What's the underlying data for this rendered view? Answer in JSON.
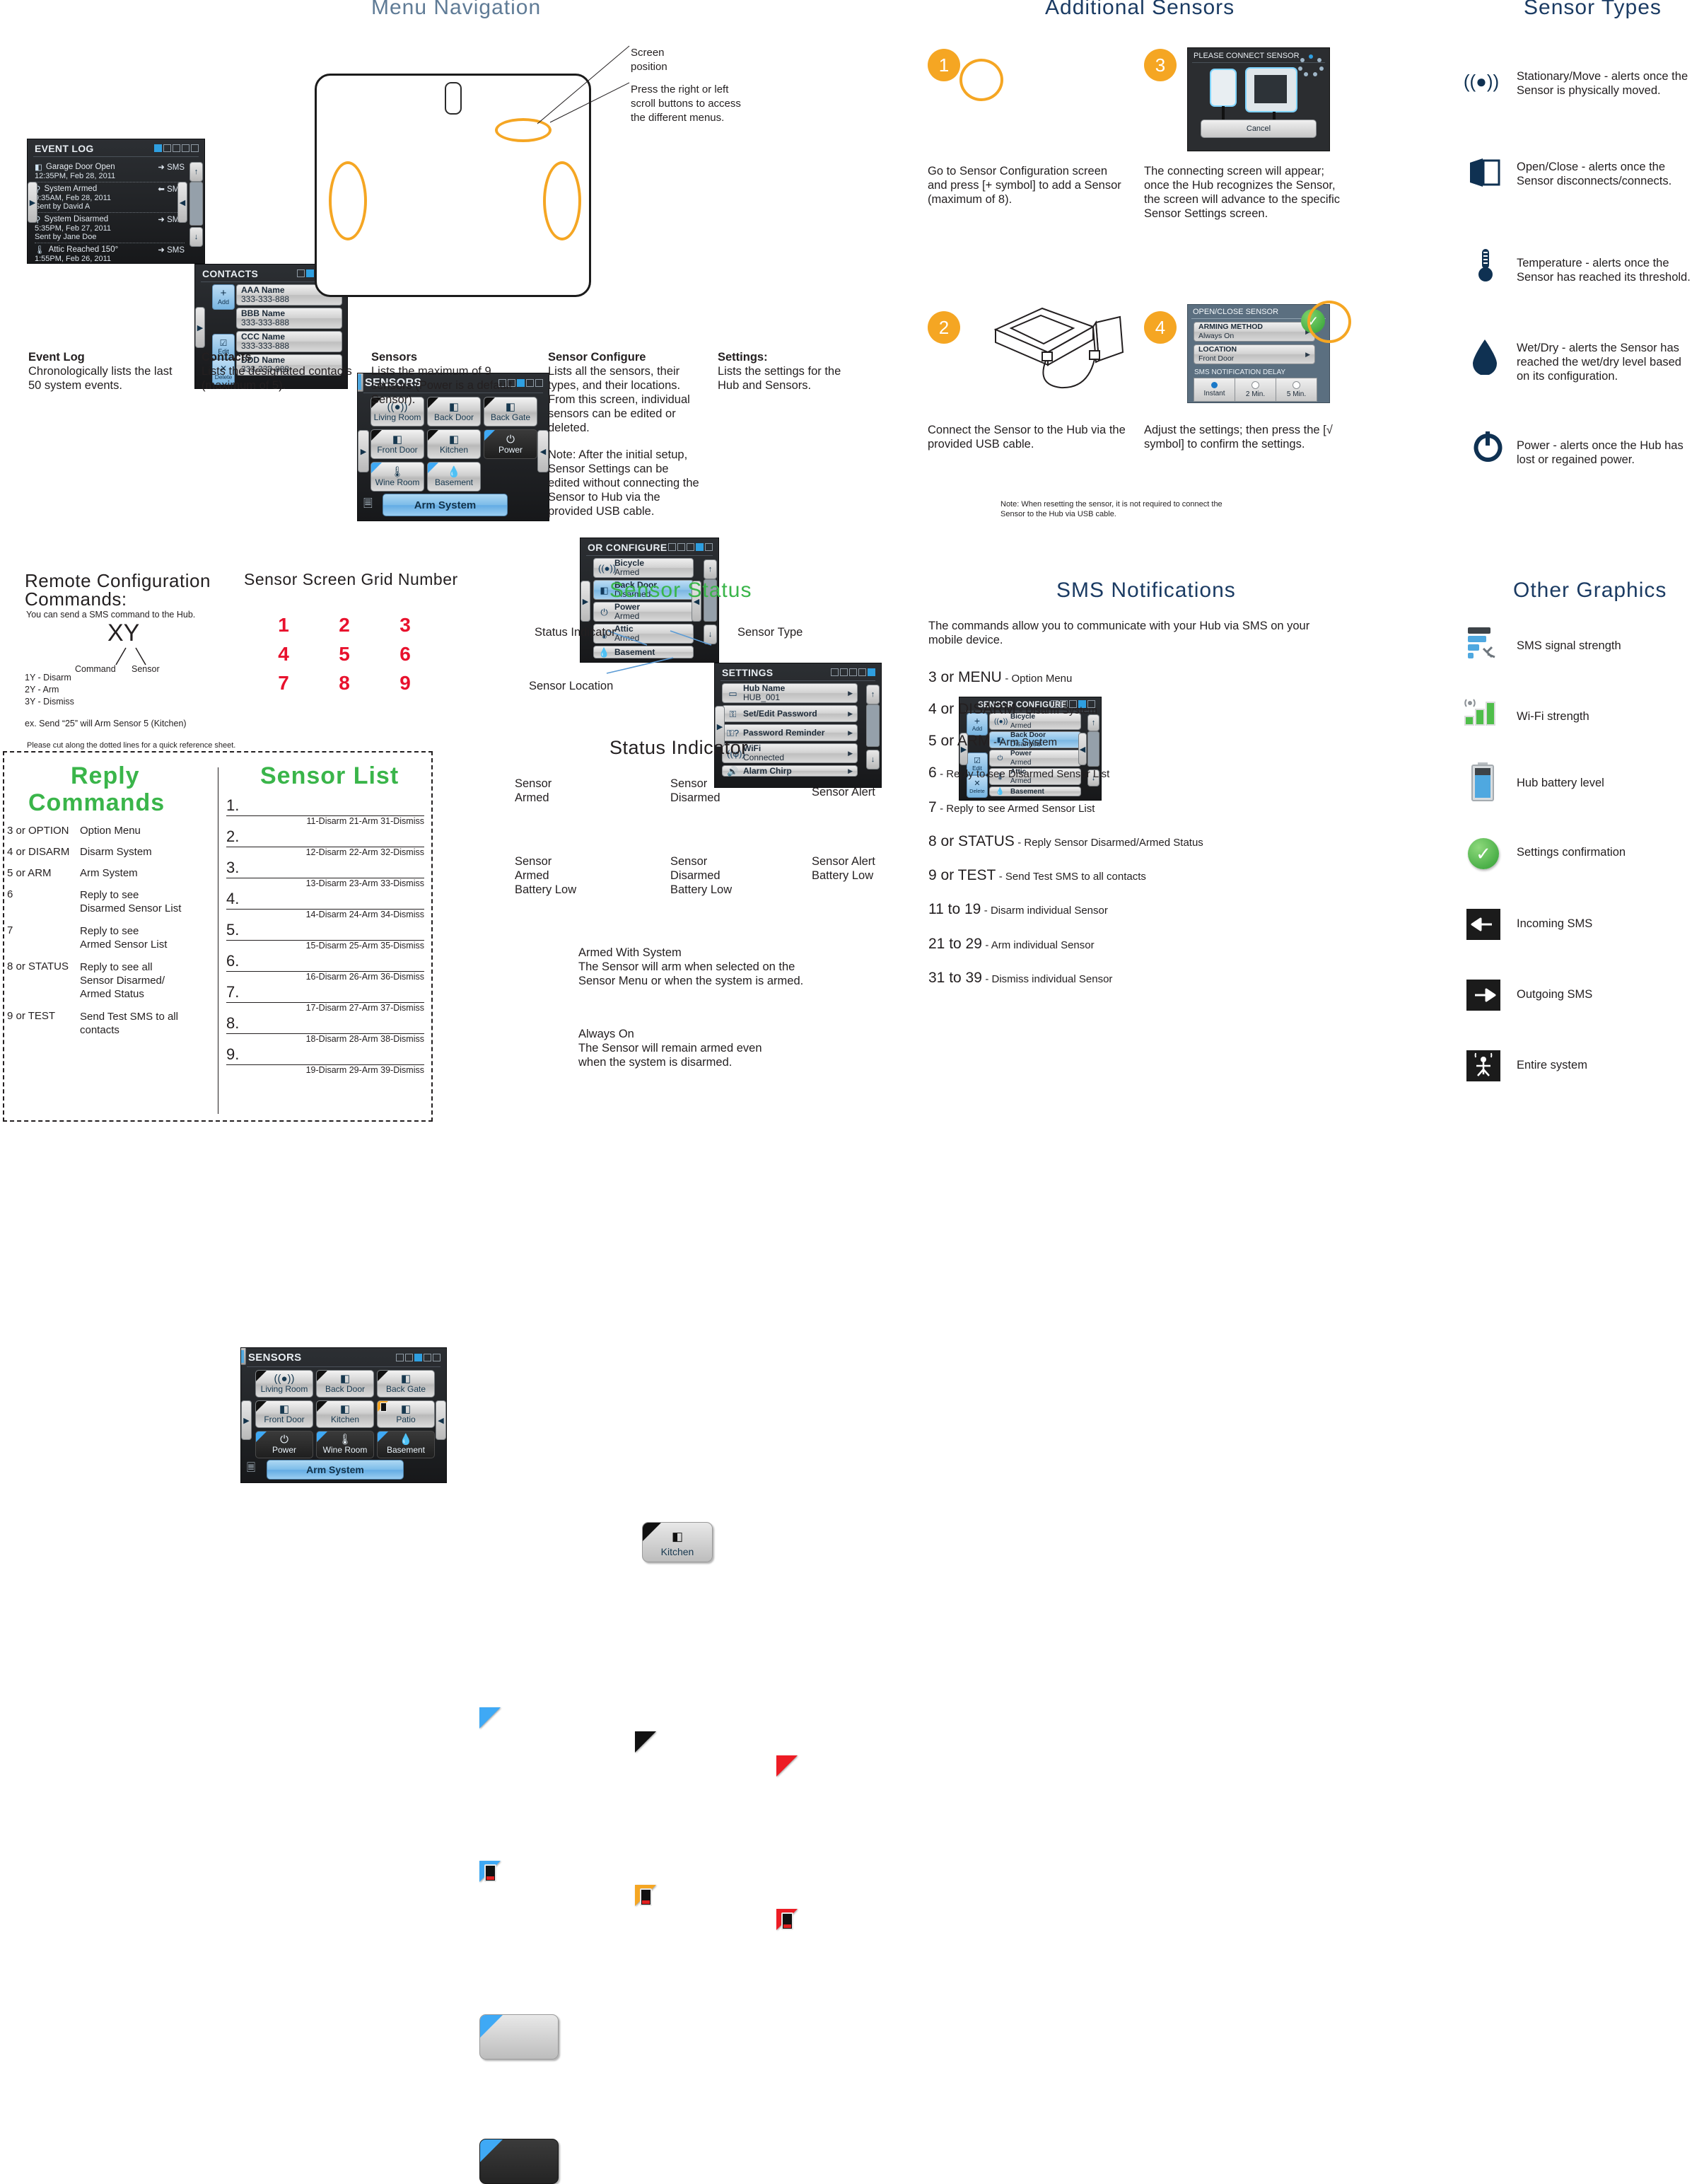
{
  "sections": {
    "menu_navigation": "Menu  Navigation",
    "additional_sensors": "Additional  Sensors",
    "sensor_types": "Sensor  Types",
    "remote_config": "Remote  Configuration",
    "remote_config2": "Commands:",
    "sensor_grid": "Sensor  Screen  Grid  Number",
    "sensor_status": "Sensor  Status",
    "status_indicator": "Status  Indicator",
    "sms_notifications": "SMS  Notifications",
    "other_graphics": "Other  Graphics",
    "reply_commands_l1": "Reply",
    "reply_commands_l2": "Commands",
    "sensor_list": "Sensor  List"
  },
  "callouts": {
    "screen_position": "Screen\nposition",
    "scroll_buttons": "Press the right or left\nscroll buttons to access\nthe different menus."
  },
  "event_log": {
    "title": "EVENT LOG",
    "page_active": 0,
    "rows": [
      {
        "icon": "open-close-icon",
        "name": "Garage Door Open",
        "time": "12:35PM, Feb 28, 2011",
        "sent": "",
        "dir": "out",
        "sms": "SMS"
      },
      {
        "icon": "system-icon",
        "name": "System Armed",
        "time": "9:35AM, Feb 28, 2011",
        "sent": "Sent by David A",
        "dir": "in",
        "sms": "SMS"
      },
      {
        "icon": "system-icon",
        "name": "System Disarmed",
        "time": "5:35PM, Feb 27, 2011",
        "sent": "Sent by Jane Doe",
        "dir": "out",
        "sms": "SMS"
      },
      {
        "icon": "temperature-icon",
        "name": "Attic Reached 150°",
        "time": "1:55PM, Feb 26, 2011",
        "sent": "",
        "dir": "out",
        "sms": "SMS"
      }
    ]
  },
  "contacts": {
    "title": "CONTACTS",
    "page_active": 1,
    "tools": [
      {
        "icon": "plus-icon",
        "label": "Add"
      },
      {
        "icon": "check-icon",
        "label": "Edit"
      },
      {
        "icon": "x-icon",
        "label": "Delete"
      }
    ],
    "rows": [
      {
        "name": "AAA Name",
        "phone": "333-333-888"
      },
      {
        "name": "BBB Name",
        "phone": "333-333-888"
      },
      {
        "name": "CCC Name",
        "phone": "333-333-888"
      },
      {
        "name": "DDD Name",
        "phone": "333-333-888"
      }
    ]
  },
  "sensors_screen": {
    "title": "SENSORS",
    "page_active": 2,
    "arm_button": "Arm System",
    "tiles": [
      {
        "name": "Living Room",
        "type": "stationary-move",
        "corner": "black"
      },
      {
        "name": "Back Door",
        "type": "open-close",
        "corner": "black"
      },
      {
        "name": "Back Gate",
        "type": "open-close",
        "corner": "black"
      },
      {
        "name": "Front Door",
        "type": "open-close",
        "corner": "black"
      },
      {
        "name": "Kitchen",
        "type": "open-close",
        "corner": "black"
      },
      {
        "name": "Power",
        "type": "power",
        "corner": "blue"
      },
      {
        "name": "Wine Room",
        "type": "temperature",
        "corner": "blue"
      },
      {
        "name": "Basement",
        "type": "wet-dry",
        "corner": "blue"
      }
    ]
  },
  "sensor_configure": {
    "title": "SENSOR CONFIGURE",
    "title_clipped": "OR CONFIGURE",
    "page_active": 3,
    "tools": [
      {
        "icon": "plus-icon",
        "label": "Add"
      },
      {
        "icon": "check-icon",
        "label": "Edit"
      },
      {
        "icon": "x-icon",
        "label": "Delete"
      }
    ],
    "rows": [
      {
        "name": "Bicycle",
        "state": "Armed",
        "type": "stationary-move",
        "selected": false
      },
      {
        "name": "Back Door",
        "state": "Disarmed",
        "type": "open-close",
        "selected": true
      },
      {
        "name": "Power",
        "state": "Armed",
        "type": "power",
        "selected": false
      },
      {
        "name": "Attic",
        "state": "Armed",
        "type": "temperature",
        "selected": false
      },
      {
        "name": "Basement",
        "state": "",
        "type": "wet-dry",
        "selected": false
      }
    ]
  },
  "settings_screen": {
    "title": "SETTINGS",
    "page_active": 4,
    "rows": [
      {
        "name": "Hub Name",
        "value": "HUB_001",
        "icon": "hub-icon"
      },
      {
        "name": "Set/Edit Password",
        "value": "",
        "icon": "key-icon"
      },
      {
        "name": "Password Reminder",
        "value": "",
        "icon": "key-question-icon"
      },
      {
        "name": "WiFi",
        "value": "Connected",
        "icon": "wifi-icon"
      },
      {
        "name": "Alarm Chirp",
        "value": "",
        "icon": "speaker-icon"
      }
    ]
  },
  "menu_descriptions": [
    {
      "title": "Event Log",
      "body": "Chronologically lists the last 50 system events."
    },
    {
      "title": "Contacts",
      "body": "Lists the designated contacts (maximum of 5)."
    },
    {
      "title": "Sensors",
      "body": "Lists the maximum of 9 sensors (Power is a default Sensor)."
    },
    {
      "title": "Sensor Configure",
      "body": "Lists all the sensors, their types, and their locations. From this screen, individual sensors can be edited or deleted.",
      "note": "Note: After the initial setup, Sensor Settings can be edited without connecting the Sensor to Hub via the provided USB cable."
    },
    {
      "title": "Settings:",
      "body": "Lists the settings for the Hub and Sensors."
    }
  ],
  "additional_steps": [
    {
      "num": "1",
      "caption": "Go to Sensor Configuration screen and press [+ symbol] to add a Sensor (maximum of 8)."
    },
    {
      "num": "3",
      "caption": "The connecting screen will appear; once the Hub recognizes the Sensor, the screen will advance to the specific Sensor Settings screen."
    },
    {
      "num": "2",
      "caption": "Connect the Sensor to the Hub via the provided USB cable."
    },
    {
      "num": "4",
      "caption": "Adjust the settings; then press the [√ symbol] to confirm the settings."
    }
  ],
  "additional_note": "Note: When resetting the sensor, it is not required to connect the\nSensor to the Hub via USB cable.",
  "connect_screen": {
    "title": "PLEASE CONNECT SENSOR",
    "cancel": "Cancel"
  },
  "openclose_screen": {
    "title": "OPEN/CLOSE SENSOR",
    "rows": [
      {
        "label": "ARMING METHOD",
        "value": "Always On"
      },
      {
        "label": "LOCATION",
        "value": "Front Door"
      }
    ],
    "delay_label": "SMS NOTIFICATION DELAY",
    "delay_options": [
      "Instant",
      "2 Min.",
      "5 Min."
    ],
    "delay_selected": 0
  },
  "sensor_types": [
    {
      "icon": "stationary-move-icon",
      "text": "Stationary/Move - alerts once the Sensor is physically moved."
    },
    {
      "icon": "open-close-icon",
      "text": "Open/Close - alerts once the Sensor disconnects/connects."
    },
    {
      "icon": "temperature-icon",
      "text": "Temperature - alerts once the Sensor has reached its threshold."
    },
    {
      "icon": "wet-dry-icon",
      "text": "Wet/Dry - alerts the Sensor has reached the wet/dry level based on its configuration."
    },
    {
      "icon": "power-icon",
      "text": "Power - alerts once the Hub has lost or regained power."
    }
  ],
  "remote_config": {
    "intro": "You can send a SMS command to the Hub.",
    "code": "XY",
    "label_command": "Command",
    "label_sensor": "Sensor",
    "lines": [
      "1Y - Disarm",
      "2Y - Arm",
      "3Y - Dismiss"
    ],
    "example": "ex. Send “25” will Arm Sensor 5  (Kitchen)"
  },
  "grid_numbers": [
    "1",
    "2",
    "3",
    "4",
    "5",
    "6",
    "7",
    "8",
    "9"
  ],
  "grid_tiles": [
    {
      "name": "Living Room",
      "type": "stationary-move",
      "corner": "black"
    },
    {
      "name": "Back Door",
      "type": "open-close",
      "corner": "black"
    },
    {
      "name": "Back Gate",
      "type": "open-close",
      "corner": "black"
    },
    {
      "name": "Front Door",
      "type": "open-close",
      "corner": "black"
    },
    {
      "name": "Kitchen",
      "type": "open-close",
      "corner": "black"
    },
    {
      "name": "Patio",
      "type": "open-close",
      "corner": "amber-batt"
    },
    {
      "name": "Power",
      "type": "power",
      "corner": "blue"
    },
    {
      "name": "Wine Room",
      "type": "temperature",
      "corner": "blue"
    },
    {
      "name": "Basement",
      "type": "wet-dry",
      "corner": "blue"
    }
  ],
  "sensor_status_diagram": {
    "status_indicator": "Status Indicator",
    "sensor_type": "Sensor Type",
    "sensor_location": "Sensor Location",
    "tile_label": "Kitchen"
  },
  "status_indicators": [
    {
      "color": "#3fa9f5",
      "battery": false,
      "label": "Sensor\nArmed"
    },
    {
      "color": "#111111",
      "battery": false,
      "label": "Sensor\nDisarmed"
    },
    {
      "color": "#ed1c24",
      "battery": false,
      "label": "Sensor Alert"
    },
    {
      "color": "#3fa9f5",
      "battery": true,
      "label": "Sensor\nArmed\nBattery Low"
    },
    {
      "color": "#f5a623",
      "battery": true,
      "label": "Sensor\nDisarmed\nBattery Low"
    },
    {
      "color": "#ed1c24",
      "battery": true,
      "label": "Sensor Alert\nBattery Low"
    }
  ],
  "arming_modes": [
    {
      "variant": "light",
      "title": "Armed With System",
      "body": "The Sensor will arm when selected on the\nSensor Menu or when the system is armed."
    },
    {
      "variant": "dark",
      "title": "Always On",
      "body": "The Sensor will remain armed even\nwhen the system is disarmed."
    }
  ],
  "sms": {
    "intro": "The commands allow you to communicate with your Hub via SMS on your mobile device.",
    "items": [
      {
        "cmd": "3 or MENU",
        "desc": "- Option Menu"
      },
      {
        "cmd": "4 or DISARM",
        "desc": "- Disarm System"
      },
      {
        "cmd": "5 or ARM",
        "desc": "- Arm System"
      },
      {
        "cmd": "6",
        "desc": "- Reply to see Disarmed Sensor List"
      },
      {
        "cmd": "7",
        "desc": "- Reply to see Armed Sensor List"
      },
      {
        "cmd": "8 or STATUS",
        "desc": "- Reply Sensor Disarmed/Armed Status"
      },
      {
        "cmd": "9 or TEST",
        "desc": "- Send Test SMS to all contacts"
      },
      {
        "cmd": "11 to 19",
        "desc": "- Disarm individual Sensor"
      },
      {
        "cmd": "21 to 29",
        "desc": "- Arm individual Sensor"
      },
      {
        "cmd": "31 to 39",
        "desc": "- Dismiss individual Sensor"
      }
    ]
  },
  "other_graphics": [
    {
      "icon": "sms-signal-icon",
      "label": "SMS signal strength"
    },
    {
      "icon": "wifi-strength-icon",
      "label": "Wi-Fi strength"
    },
    {
      "icon": "battery-icon",
      "label": "Hub battery level"
    },
    {
      "icon": "check-circle-icon",
      "label": "Settings confirmation"
    },
    {
      "icon": "incoming-sms-icon",
      "label": "Incoming SMS"
    },
    {
      "icon": "outgoing-sms-icon",
      "label": "Outgoing SMS"
    },
    {
      "icon": "entire-system-icon",
      "label": "Entire system"
    }
  ],
  "cut_note": "Please cut along the dotted lines for a quick reference sheet.",
  "reply_commands": [
    {
      "cmd": "3 or OPTION",
      "desc": "Option Menu"
    },
    {
      "cmd": "4 or DISARM",
      "desc": "Disarm System"
    },
    {
      "cmd": "5 or ARM",
      "desc": "Arm System"
    },
    {
      "cmd": "6",
      "desc": "Reply to see\nDisarmed Sensor List"
    },
    {
      "cmd": "7",
      "desc": "Reply to see\nArmed Sensor List"
    },
    {
      "cmd": "8 or STATUS",
      "desc": "Reply to see all\nSensor Disarmed/\nArmed Status"
    },
    {
      "cmd": "9 or TEST",
      "desc": "Send Test SMS to all\ncontacts"
    }
  ],
  "sensor_list_rows": [
    {
      "n": "1.",
      "codes": "11-Disarm  21-Arm  31-Dismiss"
    },
    {
      "n": "2.",
      "codes": "12-Disarm  22-Arm  32-Dismiss"
    },
    {
      "n": "3.",
      "codes": "13-Disarm  23-Arm  33-Dismiss"
    },
    {
      "n": "4.",
      "codes": "14-Disarm  24-Arm  34-Dismiss"
    },
    {
      "n": "5.",
      "codes": "15-Disarm  25-Arm  35-Dismiss"
    },
    {
      "n": "6.",
      "codes": "16-Disarm  26-Arm  36-Dismiss"
    },
    {
      "n": "7.",
      "codes": "17-Disarm  27-Arm  37-Dismiss"
    },
    {
      "n": "8.",
      "codes": "18-Disarm  28-Arm  38-Dismiss"
    },
    {
      "n": "9.",
      "codes": "19-Disarm  29-Arm  39-Dismiss"
    }
  ],
  "colors": {
    "accent_orange": "#f5a623",
    "accent_blue": "#3fa9f5",
    "heading_blue": "#1b3b63",
    "heading_green": "#3ab54a",
    "alert_red": "#ed1c24"
  }
}
